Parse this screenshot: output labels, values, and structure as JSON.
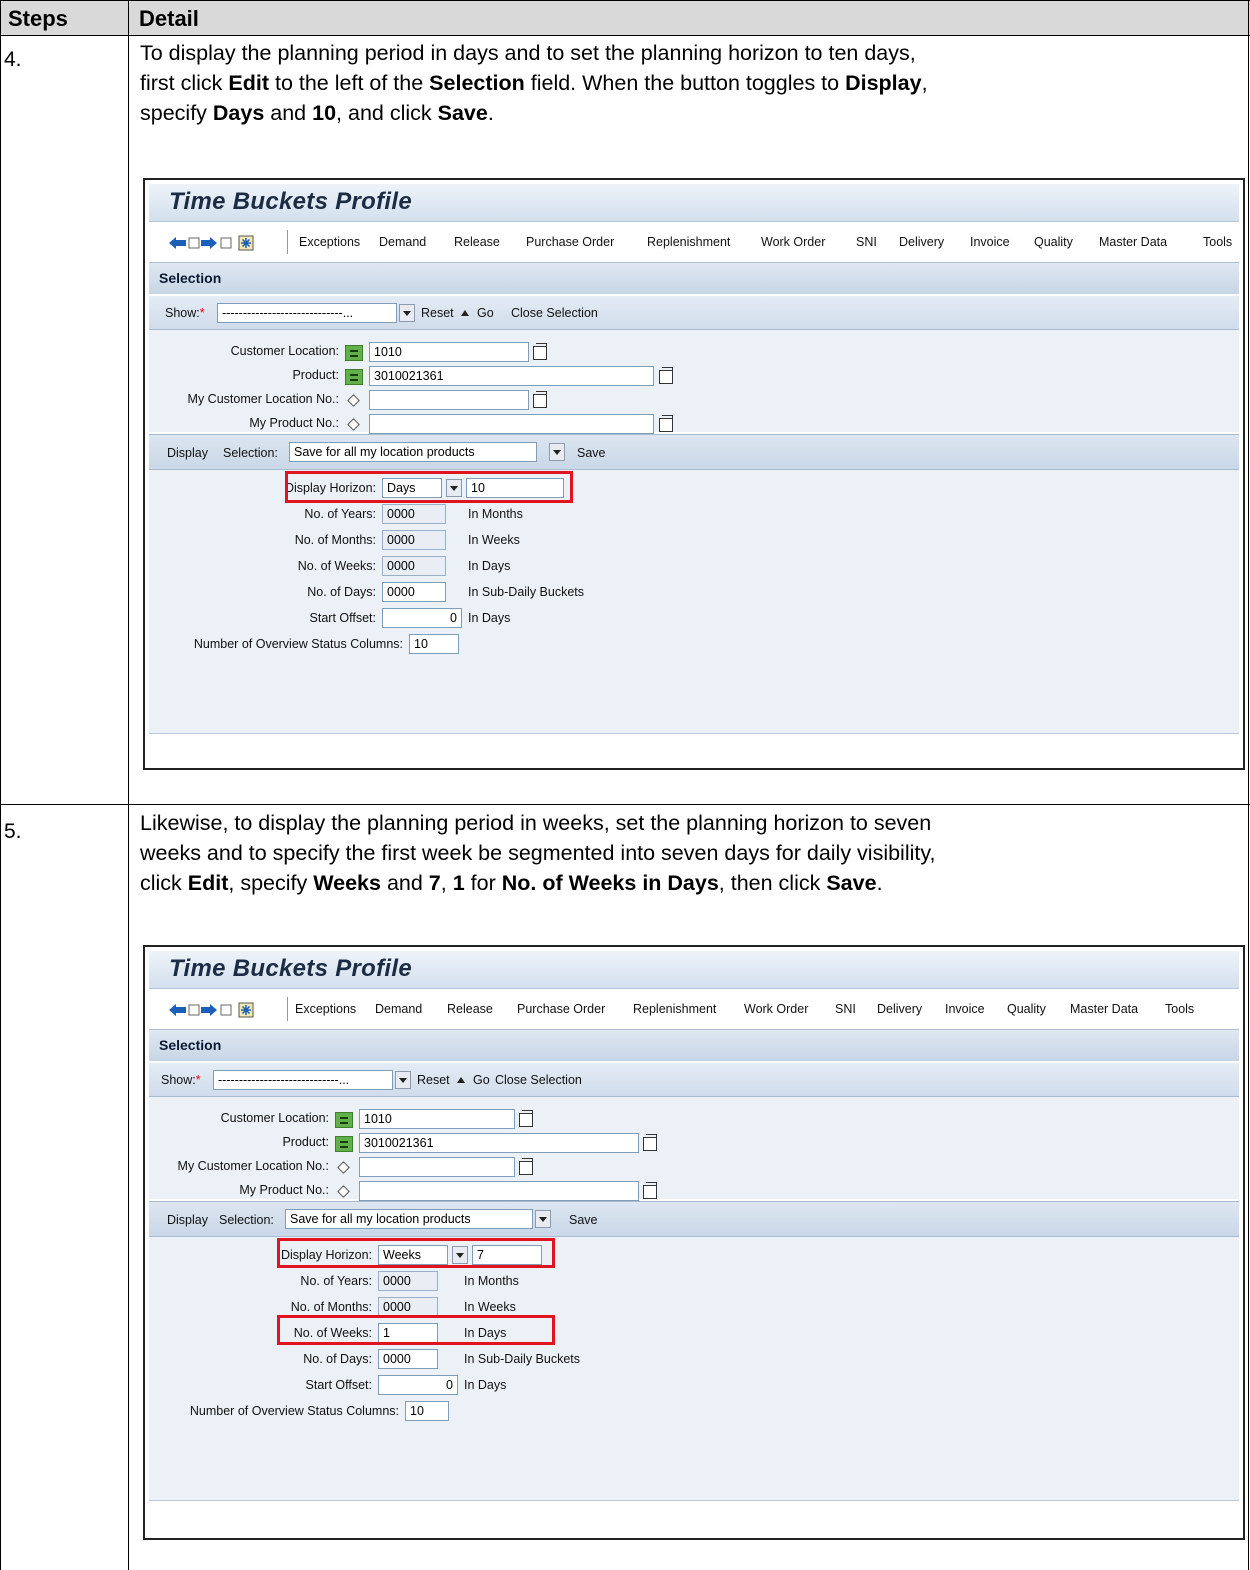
{
  "table": {
    "col_steps": "Steps",
    "col_detail": "Detail"
  },
  "step4": {
    "number": "4.",
    "line1": "To display the planning period in days and to set the planning horizon to ten days,",
    "line2_a": "first click ",
    "line2_b": "Edit",
    "line2_c": " to the left of the ",
    "line2_d": "Selection",
    "line2_e": " field. When the button toggles to ",
    "line2_f": "Display",
    "line2_g": ",",
    "line3_a": "specify ",
    "line3_b": "Days",
    "line3_c": " and ",
    "line3_d": "10",
    "line3_e": ", and click ",
    "line3_f": "Save",
    "line3_g": ".",
    "screen": {
      "title": "Time Buckets Profile",
      "menu": [
        "Exceptions",
        "Demand",
        "Release",
        "Purchase Order",
        "Replenishment",
        "Work Order",
        "SNI",
        "Delivery",
        "Invoice",
        "Quality",
        "Master Data",
        "Tools"
      ],
      "selection_header": "Selection",
      "show_label": "Show:",
      "required_mark": "*",
      "show_value": "-----------------------------...",
      "reset": "Reset",
      "go": "Go",
      "close_selection": "Close Selection",
      "customer_location_label": "Customer Location:",
      "customer_location_value": "1010",
      "product_label": "Product:",
      "product_value": "3010021361",
      "my_customer_location_label": "My Customer Location No.:",
      "my_customer_location_value": "",
      "my_product_label": "My Product No.:",
      "my_product_value": "",
      "display_button": "Display",
      "selection_label": "Selection:",
      "selection_value": "Save for all my location products",
      "save_button": "Save",
      "display_horizon_label": "Display Horizon:",
      "display_horizon_unit": "Days",
      "display_horizon_value": "10",
      "years_label": "No. of Years:",
      "years_value": "0000",
      "years_unit": "In Months",
      "months_label": "No. of Months:",
      "months_value": "0000",
      "months_unit": "In Weeks",
      "weeks_label": "No. of Weeks:",
      "weeks_value": "0000",
      "weeks_unit": "In Days",
      "days_label": "No. of Days:",
      "days_value": "0000",
      "days_unit": "In Sub-Daily Buckets",
      "offset_label": "Start Offset:",
      "offset_value": "0",
      "offset_unit": "In Days",
      "overview_label": "Number of Overview Status Columns:",
      "overview_value": "10"
    }
  },
  "step5": {
    "number": "5.",
    "line1": "Likewise, to display the planning period in weeks, set the planning horizon to seven",
    "line2": "weeks and to specify the first week be segmented into seven days for daily visibility,",
    "line3_a": "click ",
    "line3_b": "Edit",
    "line3_c": ", specify ",
    "line3_d": "Weeks",
    "line3_e": " and ",
    "line3_f": "7",
    "line3_g": ", ",
    "line3_h": "1",
    "line3_i": " for ",
    "line3_j": "No. of Weeks in Days",
    "line3_k": ", then click ",
    "line3_l": "Save",
    "line3_m": ".",
    "screen": {
      "title": "Time Buckets Profile",
      "menu": [
        "Exceptions",
        "Demand",
        "Release",
        "Purchase Order",
        "Replenishment",
        "Work Order",
        "SNI",
        "Delivery",
        "Invoice",
        "Quality",
        "Master Data",
        "Tools"
      ],
      "selection_header": "Selection",
      "show_label": "Show:",
      "required_mark": "*",
      "show_value": "-----------------------------...",
      "reset": "Reset",
      "go": "Go",
      "close_selection": "Close Selection",
      "customer_location_label": "Customer Location:",
      "customer_location_value": "1010",
      "product_label": "Product:",
      "product_value": "3010021361",
      "my_customer_location_label": "My Customer Location No.:",
      "my_customer_location_value": "",
      "my_product_label": "My Product No.:",
      "my_product_value": "",
      "display_button": "Display",
      "selection_label": "Selection:",
      "selection_value": "Save for all my location products",
      "save_button": "Save",
      "display_horizon_label": "Display Horizon:",
      "display_horizon_unit": "Weeks",
      "display_horizon_value": "7",
      "years_label": "No. of Years:",
      "years_value": "0000",
      "years_unit": "In Months",
      "months_label": "No. of Months:",
      "months_value": "0000",
      "months_unit": "In Weeks",
      "weeks_label": "No. of Weeks:",
      "weeks_value": "1",
      "weeks_unit": "In Days",
      "days_label": "No. of Days:",
      "days_value": "0000",
      "days_unit": "In Sub-Daily Buckets",
      "offset_label": "Start Offset:",
      "offset_value": "0",
      "offset_unit": "In Days",
      "overview_label": "Number of Overview Status Columns:",
      "overview_value": "10"
    }
  },
  "colors": {
    "highlight": "#e0141e",
    "header_fill": "#d9d9d9",
    "sap_band": "#c9d7e7"
  }
}
